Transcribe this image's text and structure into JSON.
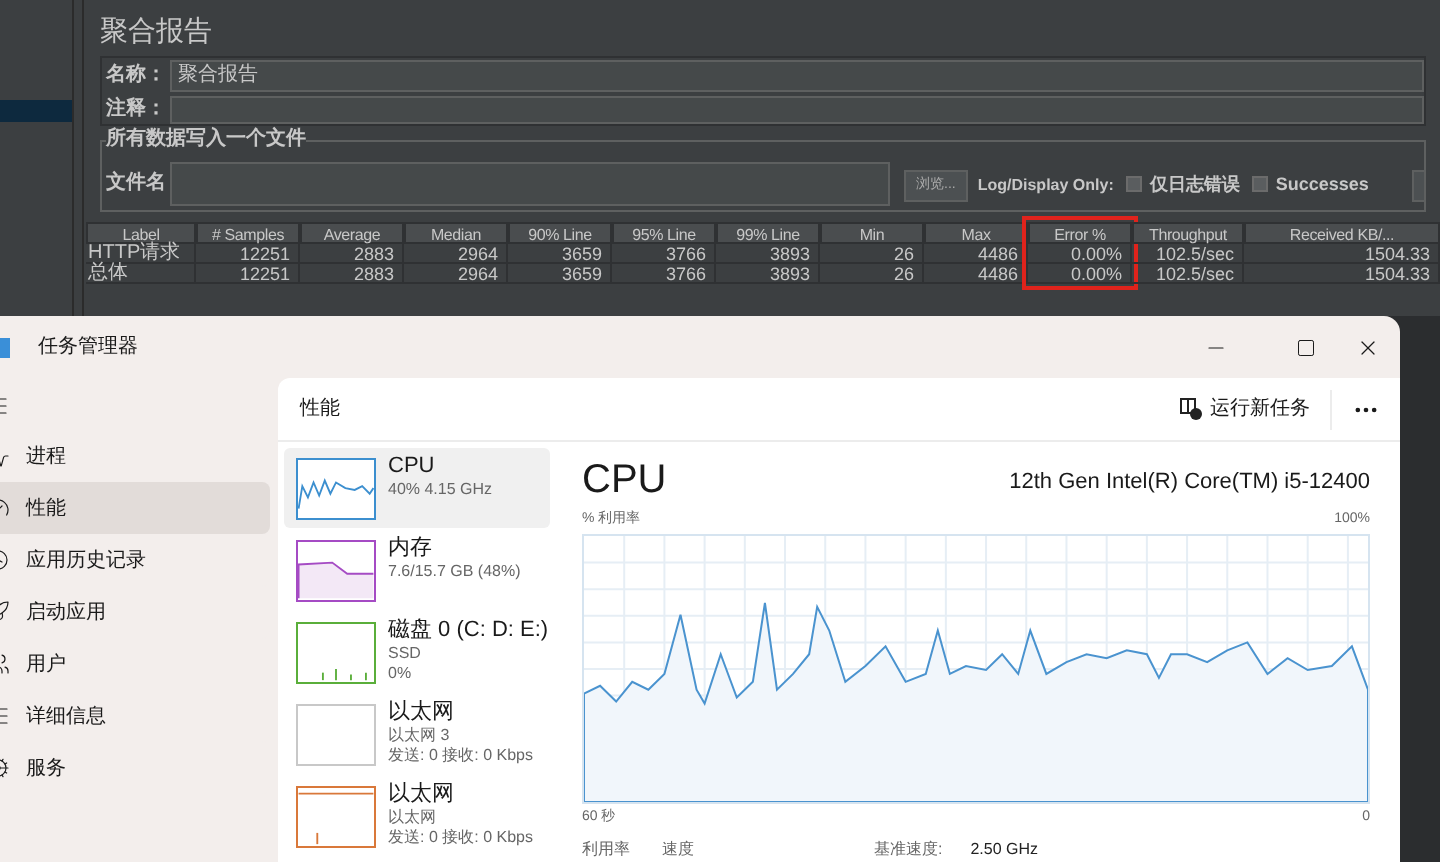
{
  "report": {
    "title": "聚合报告",
    "name_label": "名称：",
    "name_value": "聚合报告",
    "comment_label": "注释：",
    "file_group_title": "所有数据写入一个文件",
    "file_label": "文件名",
    "browse_button": "浏览...",
    "log_display_label": "Log/Display Only:",
    "checkboxes": [
      {
        "label": "仅日志错误",
        "checked": false
      },
      {
        "label": "Successes",
        "checked": false
      }
    ],
    "table": {
      "columns": [
        {
          "label": "Label",
          "highlighted": false
        },
        {
          "label": "# Samples",
          "highlighted": false
        },
        {
          "label": "Average",
          "highlighted": false
        },
        {
          "label": "Median",
          "highlighted": false
        },
        {
          "label": "90% Line",
          "highlighted": false
        },
        {
          "label": "95% Line",
          "highlighted": false
        },
        {
          "label": "99% Line",
          "highlighted": false
        },
        {
          "label": "Min",
          "highlighted": false
        },
        {
          "label": "Max",
          "highlighted": false
        },
        {
          "label": "Error %",
          "highlighted": true
        },
        {
          "label": "Throughput",
          "highlighted": false
        },
        {
          "label": "Received KB/...",
          "highlighted": false
        }
      ],
      "rows": [
        [
          "HTTP请求",
          "12251",
          "2883",
          "2964",
          "3659",
          "3766",
          "3893",
          "26",
          "4486",
          "0.00%",
          "102.5/sec",
          "1504.33"
        ],
        [
          "总体",
          "12251",
          "2883",
          "2964",
          "3659",
          "3766",
          "3893",
          "26",
          "4486",
          "0.00%",
          "102.5/sec",
          "1504.33"
        ]
      ]
    }
  },
  "task_manager": {
    "title": "任务管理器",
    "nav": [
      {
        "label": "进程",
        "selected": false
      },
      {
        "label": "性能",
        "selected": true
      },
      {
        "label": "应用历史记录",
        "selected": false
      },
      {
        "label": "启动应用",
        "selected": false
      },
      {
        "label": "用户",
        "selected": false
      },
      {
        "label": "详细信息",
        "selected": false
      },
      {
        "label": "服务",
        "selected": false
      }
    ],
    "section_title": "性能",
    "run_task_button": "运行新任务",
    "devices": [
      {
        "kind": "cpu",
        "name": "CPU",
        "lines": [
          "40% 4.15 GHz"
        ],
        "color": "#3c8fcf",
        "selected": true
      },
      {
        "kind": "memory",
        "name": "内存",
        "lines": [
          "7.6/15.7 GB (48%)"
        ],
        "color": "#a54bc4",
        "selected": false
      },
      {
        "kind": "disk",
        "name": "磁盘 0 (C: D: E:)",
        "lines": [
          "SSD",
          "0%"
        ],
        "color": "#5aae3a",
        "selected": false
      },
      {
        "kind": "ethernet",
        "name": "以太网",
        "lines": [
          "以太网 3",
          "发送: 0 接收: 0 Kbps"
        ],
        "color": "#c8c8c8",
        "selected": false
      },
      {
        "kind": "ethernet_active",
        "name": "以太网",
        "lines": [
          "以太网",
          "发送: 0 接收: 0 Kbps"
        ],
        "color": "#d9783a",
        "selected": false
      }
    ],
    "detail": {
      "title": "CPU",
      "model": "12th Gen Intel(R) Core(TM) i5-12400",
      "y_label": "% 利用率",
      "y_max": "100%",
      "x_start": "60 秒",
      "x_end": "0",
      "stats": [
        {
          "label": "利用率"
        },
        {
          "label": "速度"
        },
        {
          "label": "基准速度:",
          "value": "2.50 GHz"
        }
      ]
    }
  }
}
